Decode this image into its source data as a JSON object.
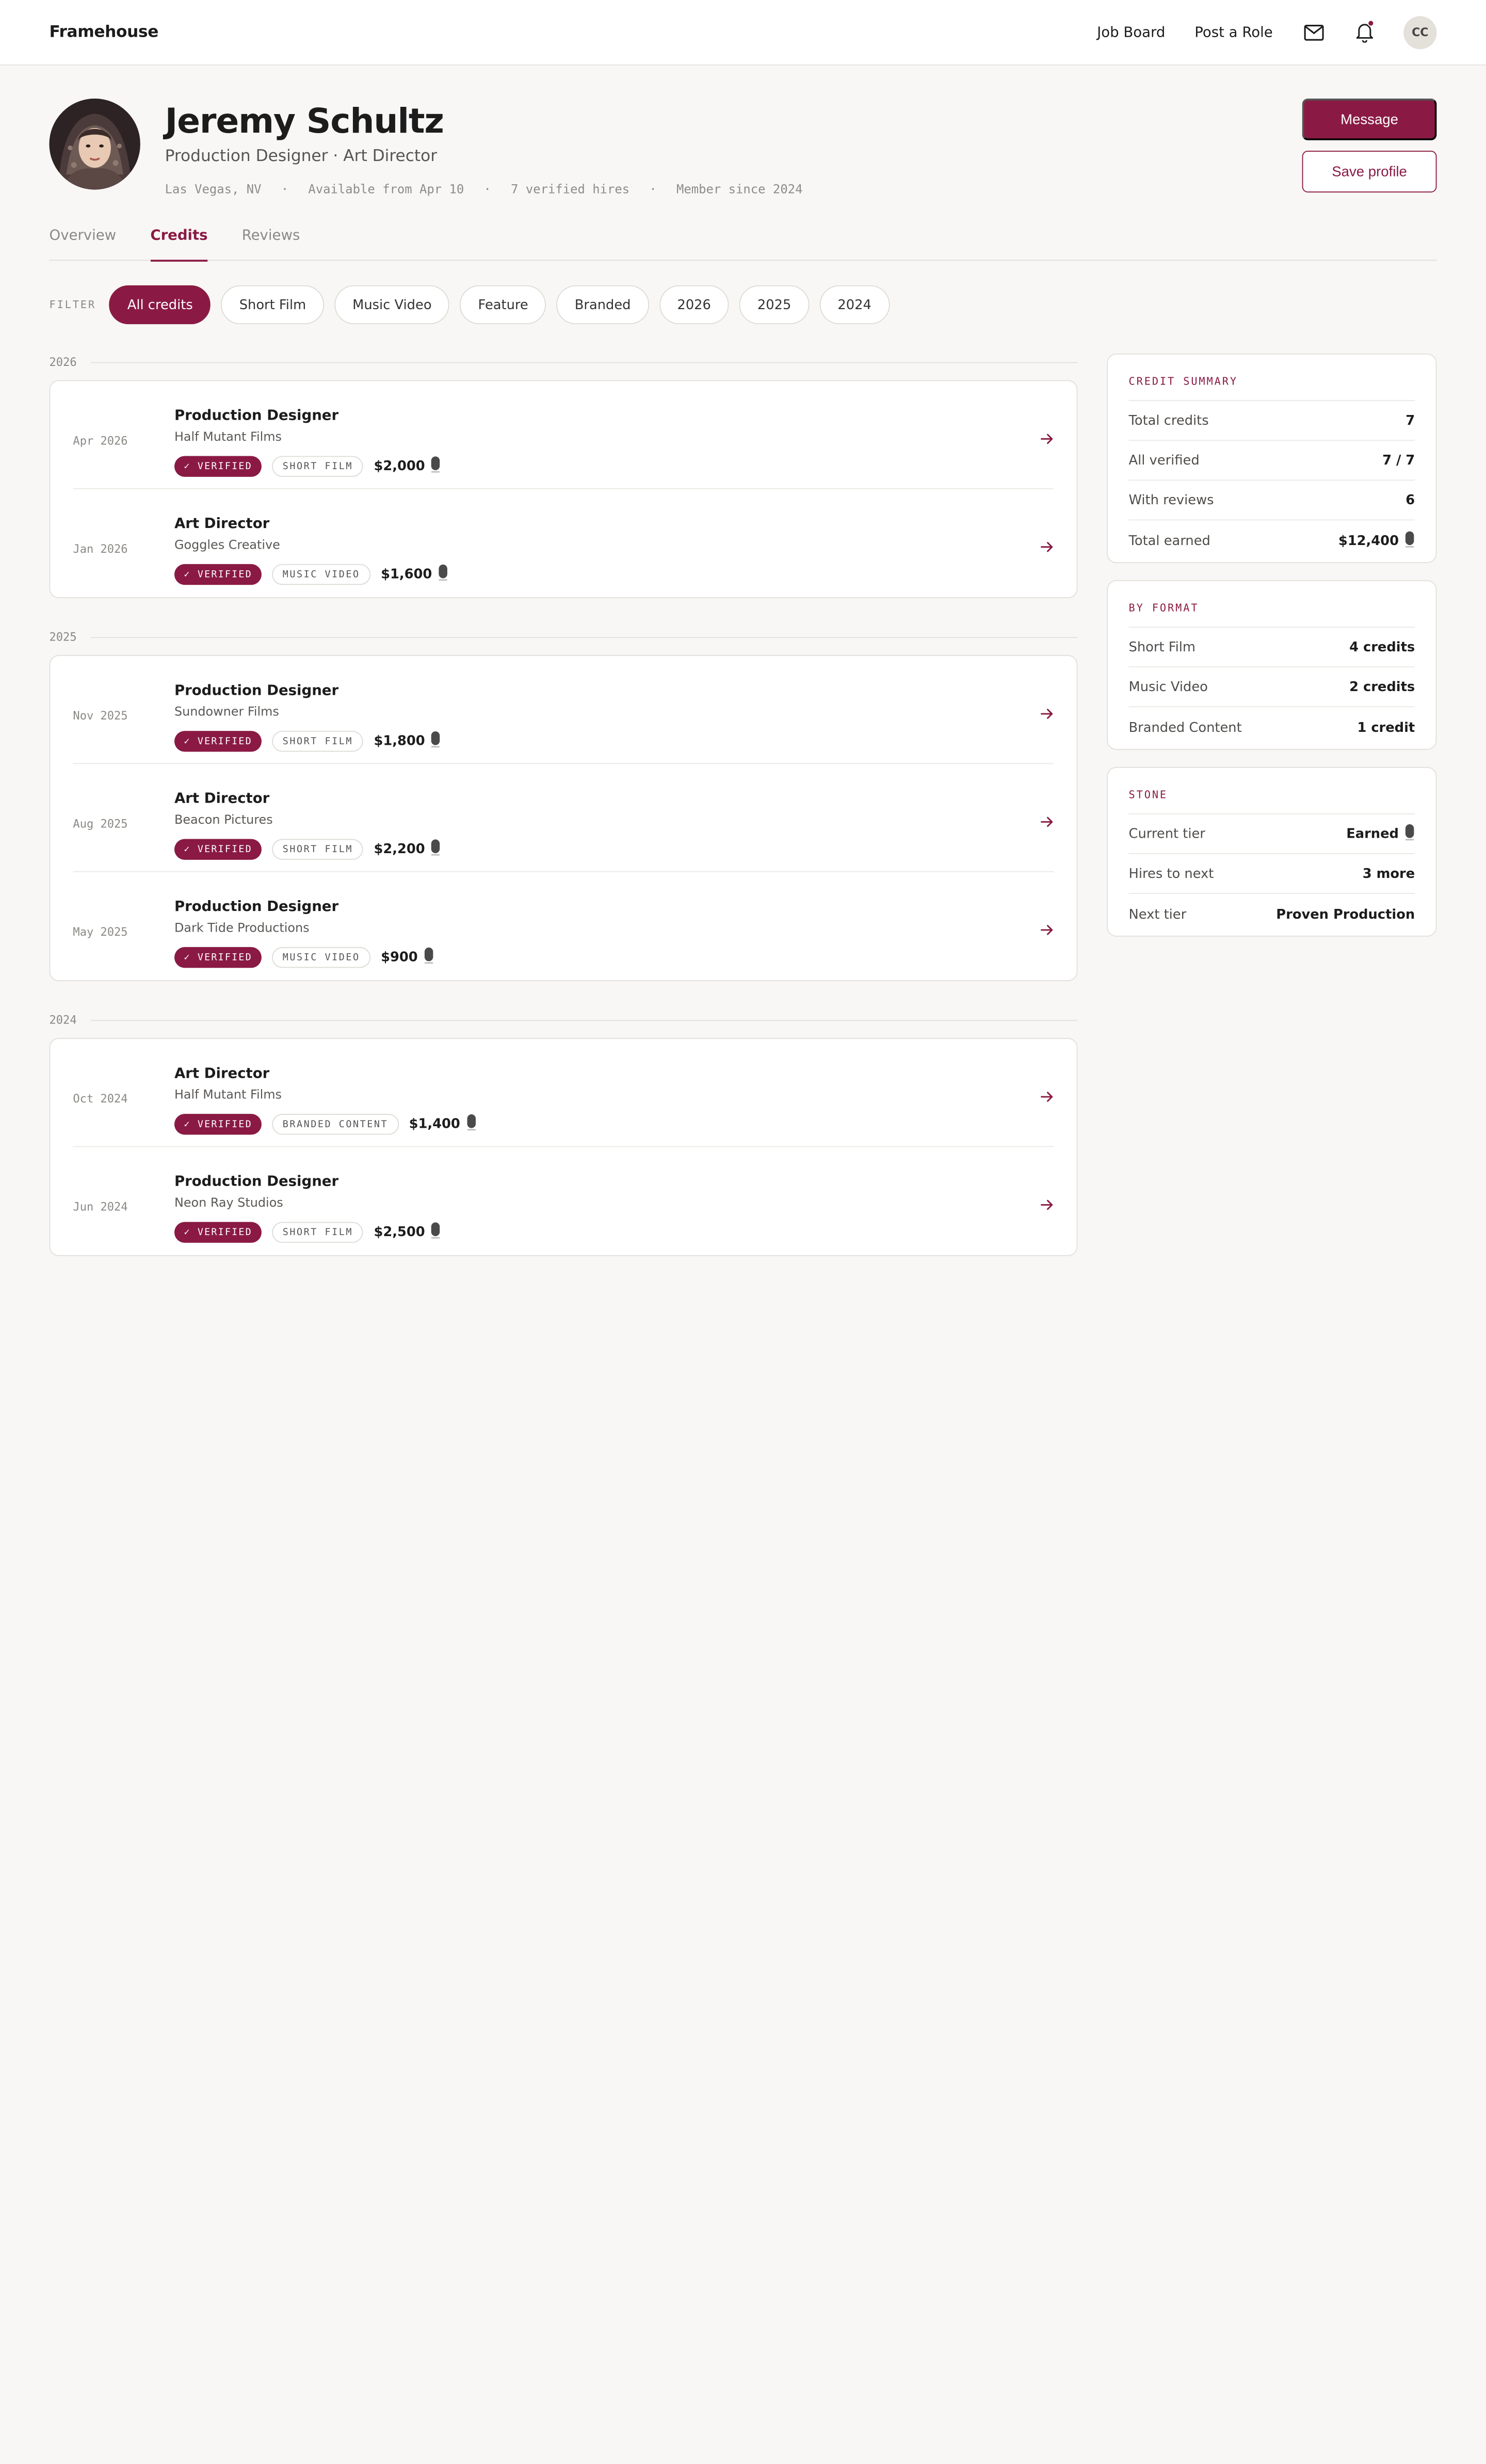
{
  "app": {
    "brand": "Framehouse"
  },
  "nav": {
    "job_board": "Job Board",
    "post_role": "Post a Role",
    "user_initials": "CC"
  },
  "profile": {
    "name": "Jeremy Schultz",
    "roles": "Production Designer · Art Director",
    "location": "Las Vegas, NV",
    "availability": "Available from Apr 10",
    "hires": "7 verified hires",
    "member_since": "Member since 2024",
    "meta_separator": "·",
    "message_label": "Message",
    "save_label": "Save profile"
  },
  "tabs": [
    {
      "label": "Overview",
      "active": false
    },
    {
      "label": "Credits",
      "active": true
    },
    {
      "label": "Reviews",
      "active": false
    }
  ],
  "filter": {
    "label": "FILTER",
    "chips": [
      "All credits",
      "Short Film",
      "Music Video",
      "Feature",
      "Branded",
      "2026",
      "2025",
      "2024"
    ],
    "active_index": 0
  },
  "credits": [
    {
      "year": "2026",
      "items": [
        {
          "date": "Apr 2026",
          "title": "Production Designer",
          "company": "Half Mutant Films",
          "verified": "✓ VERIFIED",
          "type": "SHORT FILM",
          "amount": "$2,000"
        },
        {
          "date": "Jan 2026",
          "title": "Art Director",
          "company": "Goggles Creative",
          "verified": "✓ VERIFIED",
          "type": "MUSIC VIDEO",
          "amount": "$1,600"
        }
      ]
    },
    {
      "year": "2025",
      "items": [
        {
          "date": "Nov 2025",
          "title": "Production Designer",
          "company": "Sundowner Films",
          "verified": "✓ VERIFIED",
          "type": "SHORT FILM",
          "amount": "$1,800"
        },
        {
          "date": "Aug 2025",
          "title": "Art Director",
          "company": "Beacon Pictures",
          "verified": "✓ VERIFIED",
          "type": "SHORT FILM",
          "amount": "$2,200"
        },
        {
          "date": "May 2025",
          "title": "Production Designer",
          "company": "Dark Tide Productions",
          "verified": "✓ VERIFIED",
          "type": "MUSIC VIDEO",
          "amount": "$900"
        }
      ]
    },
    {
      "year": "2024",
      "items": [
        {
          "date": "Oct 2024",
          "title": "Art Director",
          "company": "Half Mutant Films",
          "verified": "✓ VERIFIED",
          "type": "BRANDED CONTENT",
          "amount": "$1,400"
        },
        {
          "date": "Jun 2024",
          "title": "Production Designer",
          "company": "Neon Ray Studios",
          "verified": "✓ VERIFIED",
          "type": "SHORT FILM",
          "amount": "$2,500"
        }
      ]
    }
  ],
  "summary": {
    "title": "CREDIT SUMMARY",
    "rows": [
      {
        "k": "Total credits",
        "v": "7"
      },
      {
        "k": "All verified",
        "v": "7 / 7"
      },
      {
        "k": "With reviews",
        "v": "6"
      },
      {
        "k": "Total earned",
        "v": "$12,400",
        "stone": true
      }
    ]
  },
  "by_format": {
    "title": "BY FORMAT",
    "rows": [
      {
        "k": "Short Film",
        "v": "4 credits"
      },
      {
        "k": "Music Video",
        "v": "2 credits"
      },
      {
        "k": "Branded Content",
        "v": "1 credit"
      }
    ]
  },
  "stone": {
    "title": "STONE",
    "rows": [
      {
        "k": "Current tier",
        "v": "Earned",
        "stone": true
      },
      {
        "k": "Hires to next",
        "v": "3 more"
      },
      {
        "k": "Next tier",
        "v": "Proven Production"
      }
    ]
  },
  "colors": {
    "accent": "#8a1a43",
    "background": "#f8f7f5"
  }
}
